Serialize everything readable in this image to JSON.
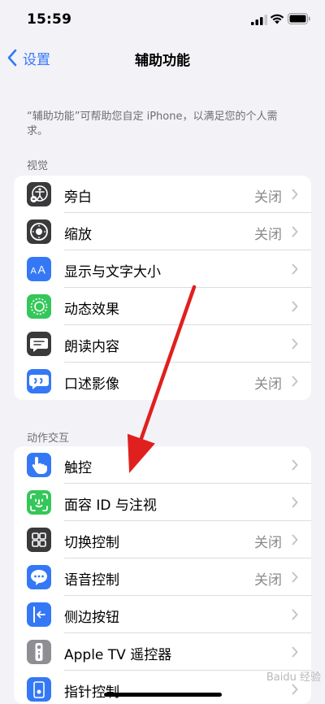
{
  "status_bar": {
    "time": "15:59"
  },
  "nav": {
    "back_label": "设置",
    "title": "辅助功能"
  },
  "description": "“辅助功能”可帮助您自定 iPhone，以满足您的个人需求。",
  "sections": [
    {
      "header": "视觉",
      "items": [
        {
          "label": "旁白",
          "value": "关闭",
          "icon": "voiceover-icon",
          "color": "#3a3a3c"
        },
        {
          "label": "缩放",
          "value": "关闭",
          "icon": "zoom-icon",
          "color": "#3a3a3c"
        },
        {
          "label": "显示与文字大小",
          "value": "",
          "icon": "text-size-icon",
          "color": "#3478f6"
        },
        {
          "label": "动态效果",
          "value": "",
          "icon": "motion-icon",
          "color": "#34c759"
        },
        {
          "label": "朗读内容",
          "value": "",
          "icon": "spoken-content-icon",
          "color": "#3a3a3c"
        },
        {
          "label": "口述影像",
          "value": "关闭",
          "icon": "audio-descriptions-icon",
          "color": "#3478f6"
        }
      ]
    },
    {
      "header": "动作交互",
      "items": [
        {
          "label": "触控",
          "value": "",
          "icon": "touch-icon",
          "color": "#3478f6"
        },
        {
          "label": "面容 ID 与注视",
          "value": "",
          "icon": "face-id-icon",
          "color": "#34c759"
        },
        {
          "label": "切换控制",
          "value": "关闭",
          "icon": "switch-control-icon",
          "color": "#3a3a3c"
        },
        {
          "label": "语音控制",
          "value": "关闭",
          "icon": "voice-control-icon",
          "color": "#3478f6"
        },
        {
          "label": "侧边按钮",
          "value": "",
          "icon": "side-button-icon",
          "color": "#3478f6"
        },
        {
          "label": "Apple TV 遥控器",
          "value": "",
          "icon": "apple-tv-remote-icon",
          "color": "#8e8e93"
        },
        {
          "label": "指针控制",
          "value": "",
          "icon": "pointer-control-icon",
          "color": "#3478f6"
        }
      ]
    }
  ],
  "watermark": "Baidu 经验",
  "colors": {
    "accent": "#3478f6",
    "arrow": "#e0201e"
  }
}
